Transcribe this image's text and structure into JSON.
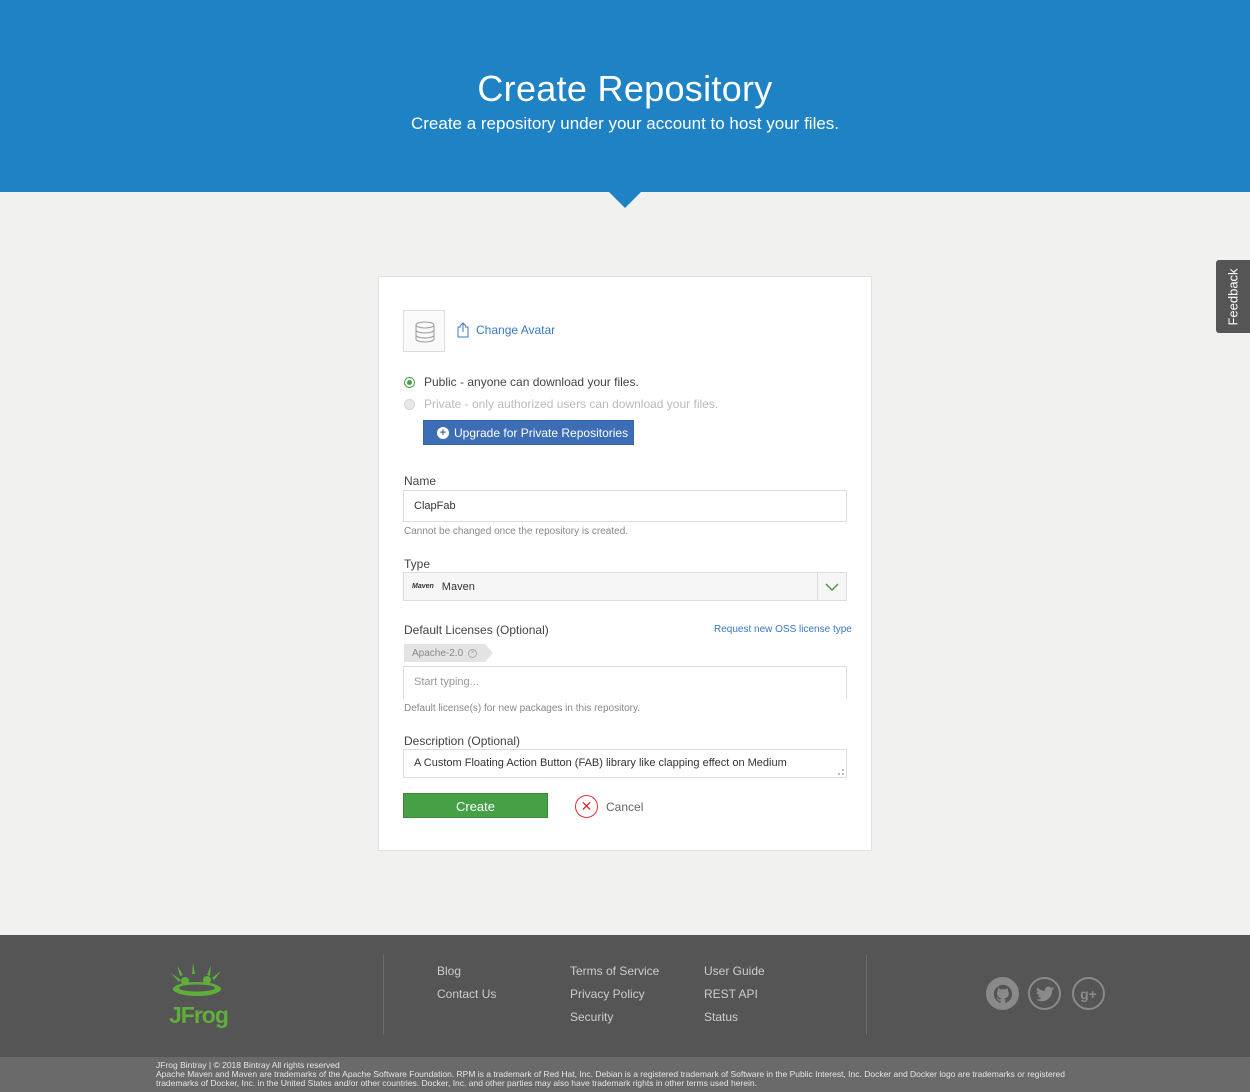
{
  "hero": {
    "title": "Create Repository",
    "subtitle": "Create a repository under your account to host your files."
  },
  "feedback_tab": "Feedback",
  "avatar": {
    "change_label": "Change Avatar"
  },
  "visibility": {
    "public_label": "Public - anyone can download your files.",
    "private_label": "Private - only authorized users can download your files.",
    "selected": "public",
    "upgrade_label": "Upgrade for Private Repositories"
  },
  "name": {
    "label": "Name",
    "value": "ClapFab",
    "hint": "Cannot be changed once the repository is created."
  },
  "type": {
    "label": "Type",
    "logo_text": "Maven",
    "value": "Maven"
  },
  "licenses": {
    "label": "Default Licenses (Optional)",
    "request_link": "Request new OSS license type",
    "tags": [
      "Apache-2.0"
    ],
    "placeholder": "Start typing...",
    "hint": "Default license(s) for new packages in this repository."
  },
  "description": {
    "label": "Description (Optional)",
    "value": "A Custom Floating Action Button (FAB) library like clapping effect on Medium"
  },
  "actions": {
    "create_label": "Create",
    "cancel_label": "Cancel"
  },
  "footer": {
    "logo_text": "JFrog",
    "col1": [
      "Blog",
      "Contact Us"
    ],
    "col2": [
      "Terms of Service",
      "Privacy Policy",
      "Security"
    ],
    "col3": [
      "User Guide",
      "REST API",
      "Status"
    ],
    "social": [
      "github-icon",
      "twitter-icon",
      "google-plus-icon"
    ],
    "copyright": "JFrog Bintray | © 2018 Bintray All rights reserved",
    "legal": "Apache Maven and Maven are trademarks of the Apache Software Foundation. RPM is a trademark of Red Hat, Inc. Debian is a registered trademark of Software in the Public Interest, Inc. Docker and Docker logo are trademarks or registered trademarks of Docker, Inc. in the United States and/or other countries. Docker, Inc. and other parties may also have trademark rights in other terms used herein."
  },
  "colors": {
    "hero_blue": "#1e82c5",
    "create_green": "#46a045",
    "upgrade_blue": "#3d6db5",
    "footer_gray": "#555555",
    "jfrog_green": "#5fae3b"
  }
}
